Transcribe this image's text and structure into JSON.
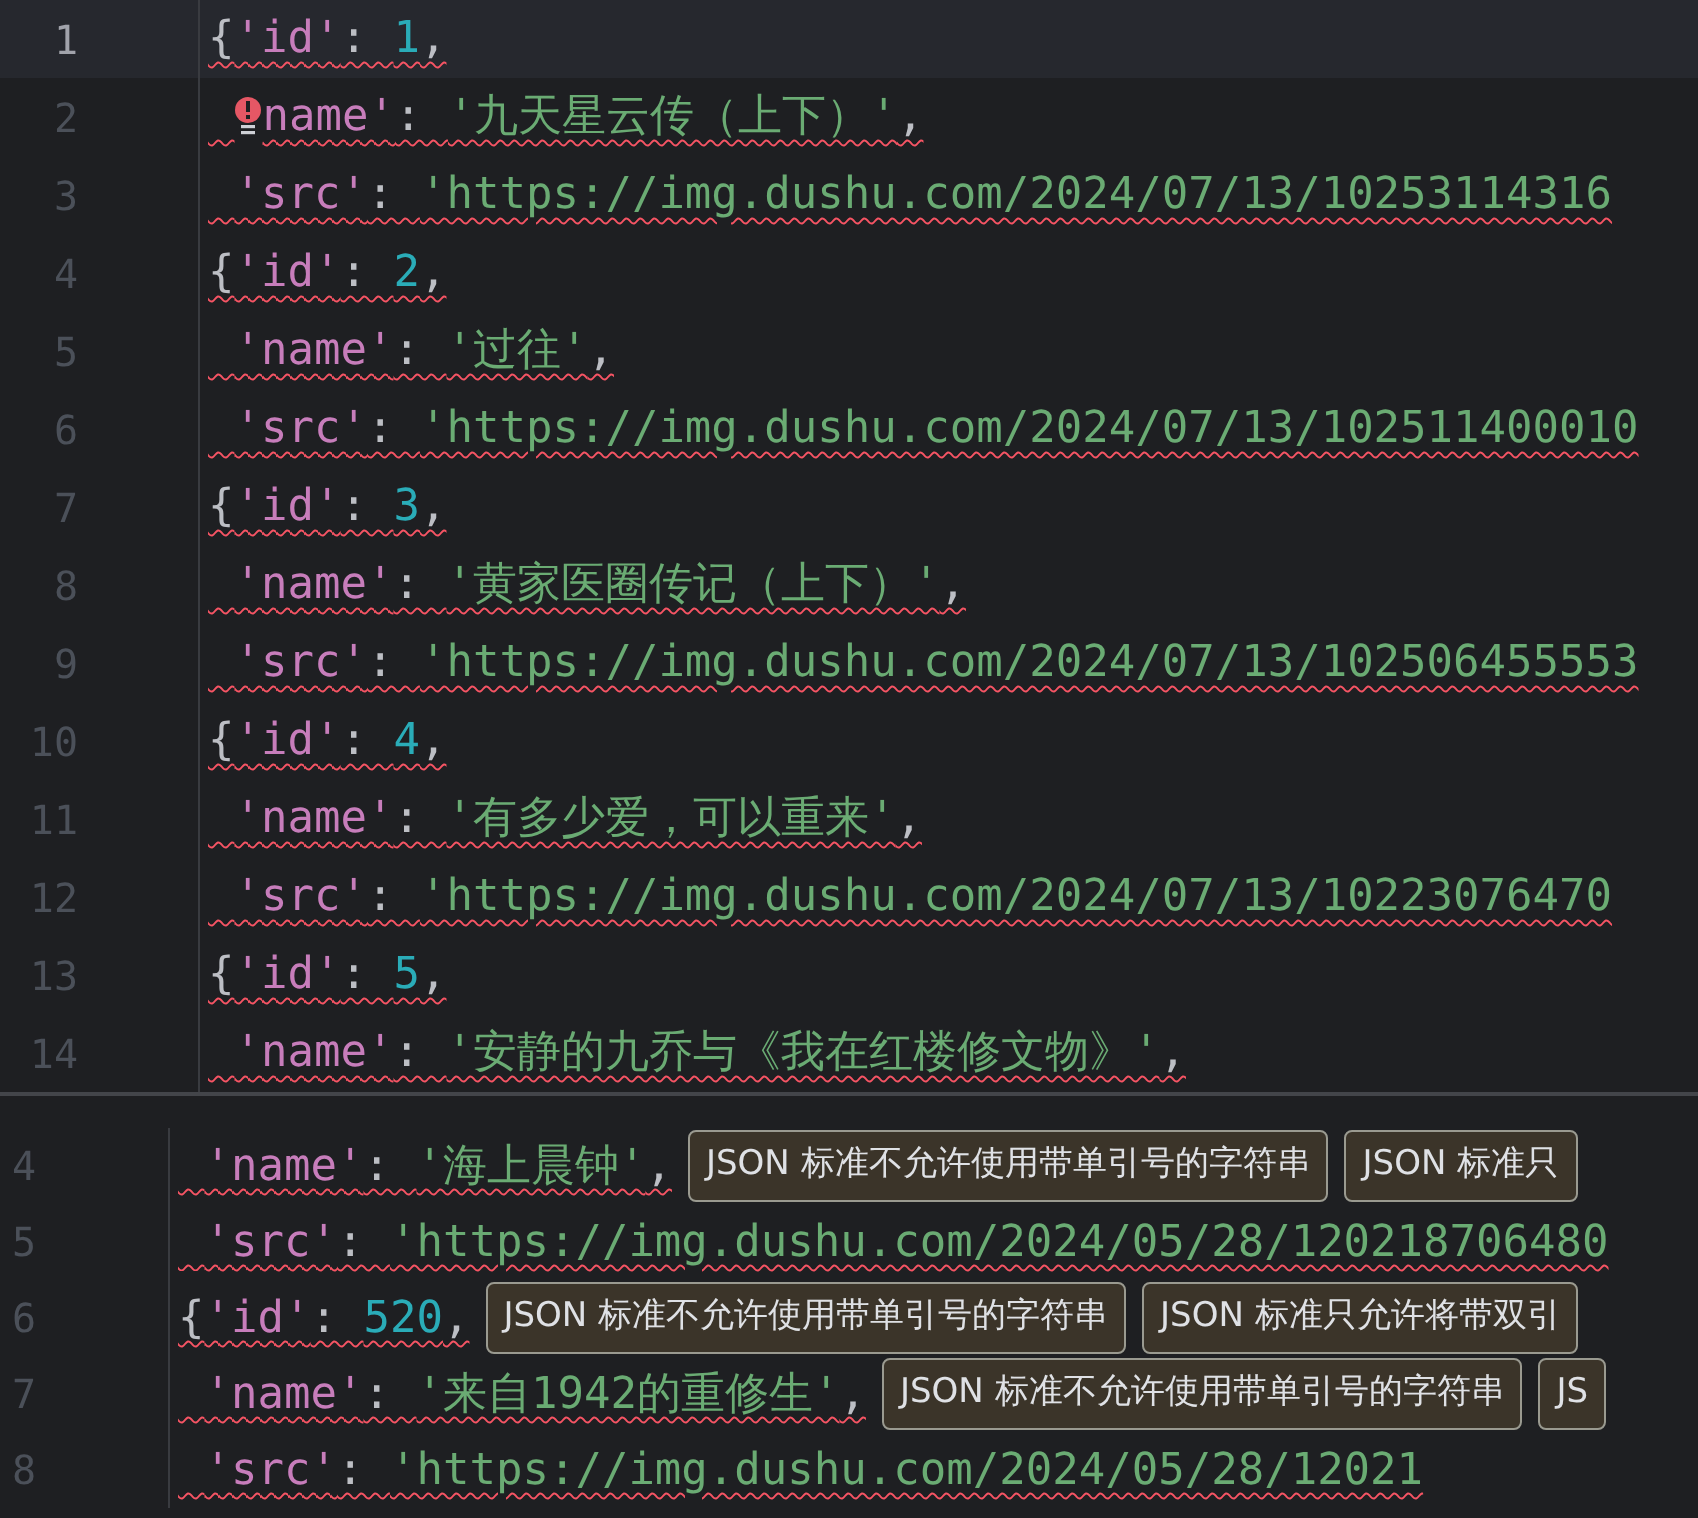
{
  "top_pane": {
    "lines": [
      {
        "number": "1",
        "selected": true,
        "error": true,
        "indent": false,
        "bulb": false,
        "tokens": [
          {
            "kind": "punct",
            "text": "{"
          },
          {
            "kind": "key",
            "text": "'id'"
          },
          {
            "kind": "punct",
            "text": ": "
          },
          {
            "kind": "number",
            "text": "1"
          },
          {
            "kind": "punct",
            "text": ","
          }
        ]
      },
      {
        "number": "2",
        "selected": false,
        "error": true,
        "indent": true,
        "bulb": true,
        "tokens": [
          {
            "kind": "key",
            "text": "name'"
          },
          {
            "kind": "punct",
            "text": ": "
          },
          {
            "kind": "string",
            "text": "'九天星云传（上下）'"
          },
          {
            "kind": "punct",
            "text": ","
          }
        ]
      },
      {
        "number": "3",
        "selected": false,
        "error": true,
        "indent": true,
        "bulb": false,
        "tokens": [
          {
            "kind": "key",
            "text": "'src'"
          },
          {
            "kind": "punct",
            "text": ": "
          },
          {
            "kind": "string",
            "text": "'https://img.dushu.com/2024/07/13/10253114316"
          }
        ]
      },
      {
        "number": "4",
        "selected": false,
        "error": true,
        "indent": false,
        "bulb": false,
        "tokens": [
          {
            "kind": "punct",
            "text": "{"
          },
          {
            "kind": "key",
            "text": "'id'"
          },
          {
            "kind": "punct",
            "text": ": "
          },
          {
            "kind": "number",
            "text": "2"
          },
          {
            "kind": "punct",
            "text": ","
          }
        ]
      },
      {
        "number": "5",
        "selected": false,
        "error": true,
        "indent": true,
        "bulb": false,
        "tokens": [
          {
            "kind": "key",
            "text": "'name'"
          },
          {
            "kind": "punct",
            "text": ": "
          },
          {
            "kind": "string",
            "text": "'过往'"
          },
          {
            "kind": "punct",
            "text": ","
          }
        ]
      },
      {
        "number": "6",
        "selected": false,
        "error": true,
        "indent": true,
        "bulb": false,
        "tokens": [
          {
            "kind": "key",
            "text": "'src'"
          },
          {
            "kind": "punct",
            "text": ": "
          },
          {
            "kind": "string",
            "text": "'https://img.dushu.com/2024/07/13/102511400010"
          }
        ]
      },
      {
        "number": "7",
        "selected": false,
        "error": true,
        "indent": false,
        "bulb": false,
        "tokens": [
          {
            "kind": "punct",
            "text": "{"
          },
          {
            "kind": "key",
            "text": "'id'"
          },
          {
            "kind": "punct",
            "text": ": "
          },
          {
            "kind": "number",
            "text": "3"
          },
          {
            "kind": "punct",
            "text": ","
          }
        ]
      },
      {
        "number": "8",
        "selected": false,
        "error": true,
        "indent": true,
        "bulb": false,
        "tokens": [
          {
            "kind": "key",
            "text": "'name'"
          },
          {
            "kind": "punct",
            "text": ": "
          },
          {
            "kind": "string",
            "text": "'黄家医圈传记（上下）'"
          },
          {
            "kind": "punct",
            "text": ","
          }
        ]
      },
      {
        "number": "9",
        "selected": false,
        "error": true,
        "indent": true,
        "bulb": false,
        "tokens": [
          {
            "kind": "key",
            "text": "'src'"
          },
          {
            "kind": "punct",
            "text": ": "
          },
          {
            "kind": "string",
            "text": "'https://img.dushu.com/2024/07/13/102506455553"
          }
        ]
      },
      {
        "number": "10",
        "selected": false,
        "error": true,
        "indent": false,
        "bulb": false,
        "tokens": [
          {
            "kind": "punct",
            "text": "{"
          },
          {
            "kind": "key",
            "text": "'id'"
          },
          {
            "kind": "punct",
            "text": ": "
          },
          {
            "kind": "number",
            "text": "4"
          },
          {
            "kind": "punct",
            "text": ","
          }
        ]
      },
      {
        "number": "11",
        "selected": false,
        "error": true,
        "indent": true,
        "bulb": false,
        "tokens": [
          {
            "kind": "key",
            "text": "'name'"
          },
          {
            "kind": "punct",
            "text": ": "
          },
          {
            "kind": "string",
            "text": "'有多少爱，可以重来'"
          },
          {
            "kind": "punct",
            "text": ","
          }
        ]
      },
      {
        "number": "12",
        "selected": false,
        "error": true,
        "indent": true,
        "bulb": false,
        "tokens": [
          {
            "kind": "key",
            "text": "'src'"
          },
          {
            "kind": "punct",
            "text": ": "
          },
          {
            "kind": "string",
            "text": "'https://img.dushu.com/2024/07/13/10223076470"
          }
        ]
      },
      {
        "number": "13",
        "selected": false,
        "error": true,
        "indent": false,
        "bulb": false,
        "tokens": [
          {
            "kind": "punct",
            "text": "{"
          },
          {
            "kind": "key",
            "text": "'id'"
          },
          {
            "kind": "punct",
            "text": ": "
          },
          {
            "kind": "number",
            "text": "5"
          },
          {
            "kind": "punct",
            "text": ","
          }
        ]
      },
      {
        "number": "14",
        "selected": false,
        "error": true,
        "indent": true,
        "bulb": false,
        "tokens": [
          {
            "kind": "key",
            "text": "'name'"
          },
          {
            "kind": "punct",
            "text": ": "
          },
          {
            "kind": "string",
            "text": "'安静的九乔与《我在红楼修文物》'"
          },
          {
            "kind": "punct",
            "text": ","
          }
        ]
      }
    ]
  },
  "bottom_pane": {
    "lines": [
      {
        "number": "4",
        "error": true,
        "indent": true,
        "tokens": [
          {
            "kind": "key",
            "text": "'name'"
          },
          {
            "kind": "punct",
            "text": ": "
          },
          {
            "kind": "string",
            "text": "'海上晨钟'"
          },
          {
            "kind": "punct",
            "text": ","
          }
        ],
        "hints": [
          "JSON 标准不允许使用带单引号的字符串",
          "JSON 标准只"
        ]
      },
      {
        "number": "5",
        "error": true,
        "indent": true,
        "tokens": [
          {
            "kind": "key",
            "text": "'src'"
          },
          {
            "kind": "punct",
            "text": ": "
          },
          {
            "kind": "string",
            "text": "'https://img.dushu.com/2024/05/28/120218706480"
          }
        ]
      },
      {
        "number": "6",
        "error": true,
        "indent": false,
        "tokens": [
          {
            "kind": "punct",
            "text": "{"
          },
          {
            "kind": "key",
            "text": "'id'"
          },
          {
            "kind": "punct",
            "text": ": "
          },
          {
            "kind": "number",
            "text": "520"
          },
          {
            "kind": "punct",
            "text": ","
          }
        ],
        "hints": [
          "JSON 标准不允许使用带单引号的字符串",
          "JSON 标准只允许将带双引"
        ]
      },
      {
        "number": "7",
        "error": true,
        "indent": true,
        "tokens": [
          {
            "kind": "key",
            "text": "'name'"
          },
          {
            "kind": "punct",
            "text": ": "
          },
          {
            "kind": "string",
            "text": "'来自1942的重修生'"
          },
          {
            "kind": "punct",
            "text": ","
          }
        ],
        "hints": [
          "JSON 标准不允许使用带单引号的字符串",
          "JS"
        ]
      },
      {
        "number": "8",
        "error": true,
        "indent": true,
        "tokens": [
          {
            "kind": "key",
            "text": "'src'"
          },
          {
            "kind": "punct",
            "text": ": "
          },
          {
            "kind": "string",
            "text": "'https://img.dushu.com/2024/05/28/12021"
          }
        ]
      }
    ]
  }
}
